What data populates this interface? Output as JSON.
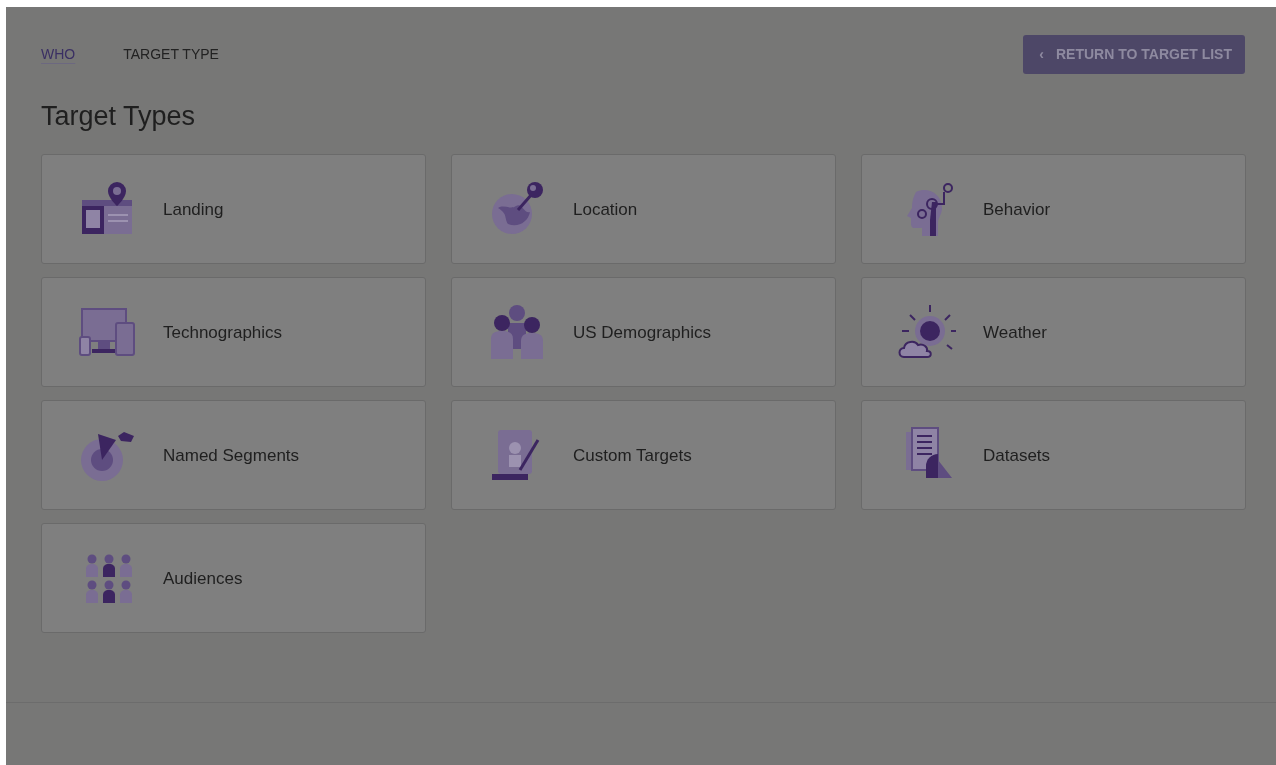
{
  "breadcrumb": [
    {
      "label": "WHO",
      "kind": "link"
    },
    {
      "label": "TARGET TYPE",
      "kind": "current"
    }
  ],
  "return_button": {
    "icon": "‹",
    "label": "RETURN TO TARGET LIST"
  },
  "title": "Target Types",
  "target_types": [
    {
      "label": "Landing",
      "kind": "landing"
    },
    {
      "label": "Location",
      "kind": "location"
    },
    {
      "label": "Behavior",
      "kind": "behavior"
    },
    {
      "label": "Technographics",
      "kind": "devices"
    },
    {
      "label": "US Demographics",
      "kind": "people"
    },
    {
      "label": "Weather",
      "kind": "weather"
    },
    {
      "label": "Named Segments",
      "kind": "segments"
    },
    {
      "label": "Custom Targets",
      "kind": "custom"
    },
    {
      "label": "Datasets",
      "kind": "datasets"
    },
    {
      "label": "Audiences",
      "kind": "audiences"
    }
  ]
}
